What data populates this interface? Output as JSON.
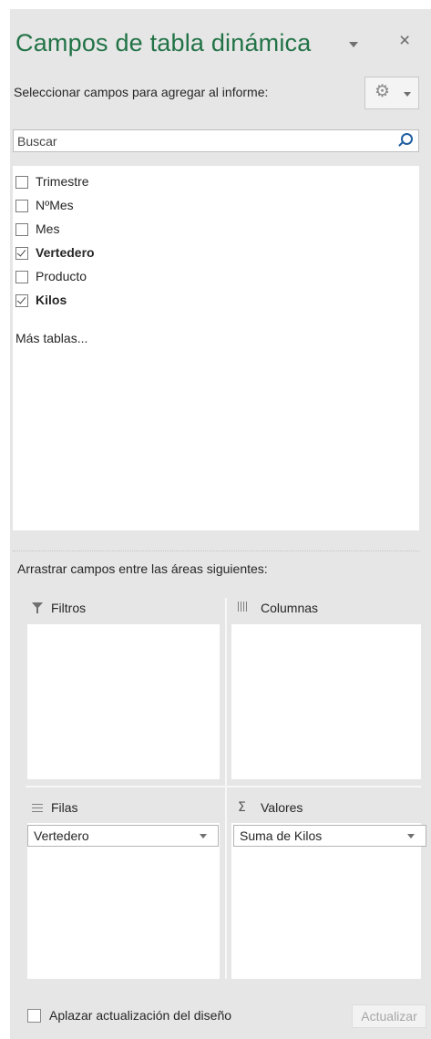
{
  "header": {
    "title": "Campos de tabla dinámica",
    "subtitle": "Seleccionar campos para agregar al informe:",
    "close_glyph": "×"
  },
  "search": {
    "placeholder": "Buscar"
  },
  "fields": [
    {
      "label": "Trimestre",
      "checked": false
    },
    {
      "label": "NºMes",
      "checked": false
    },
    {
      "label": "Mes",
      "checked": false
    },
    {
      "label": "Vertedero",
      "checked": true
    },
    {
      "label": "Producto",
      "checked": false
    },
    {
      "label": "Kilos",
      "checked": true
    }
  ],
  "more_tables": "Más tablas...",
  "areas": {
    "instruction": "Arrastrar campos entre las áreas siguientes:",
    "filters": {
      "label": "Filtros",
      "items": []
    },
    "columns": {
      "label": "Columnas",
      "items": []
    },
    "rows": {
      "label": "Filas",
      "items": [
        "Vertedero"
      ]
    },
    "values": {
      "label": "Valores",
      "sigma": "Σ",
      "items": [
        "Suma de Kilos"
      ]
    }
  },
  "footer": {
    "defer_label": "Aplazar actualización del diseño",
    "defer_checked": false,
    "update_label": "Actualizar"
  },
  "icons": {
    "tools": "gear-icon",
    "search": "search-icon",
    "close": "close-icon"
  },
  "colors": {
    "accent": "#217346",
    "pane_bg": "#e6e6e6",
    "search_icon": "#1f5fa0"
  }
}
